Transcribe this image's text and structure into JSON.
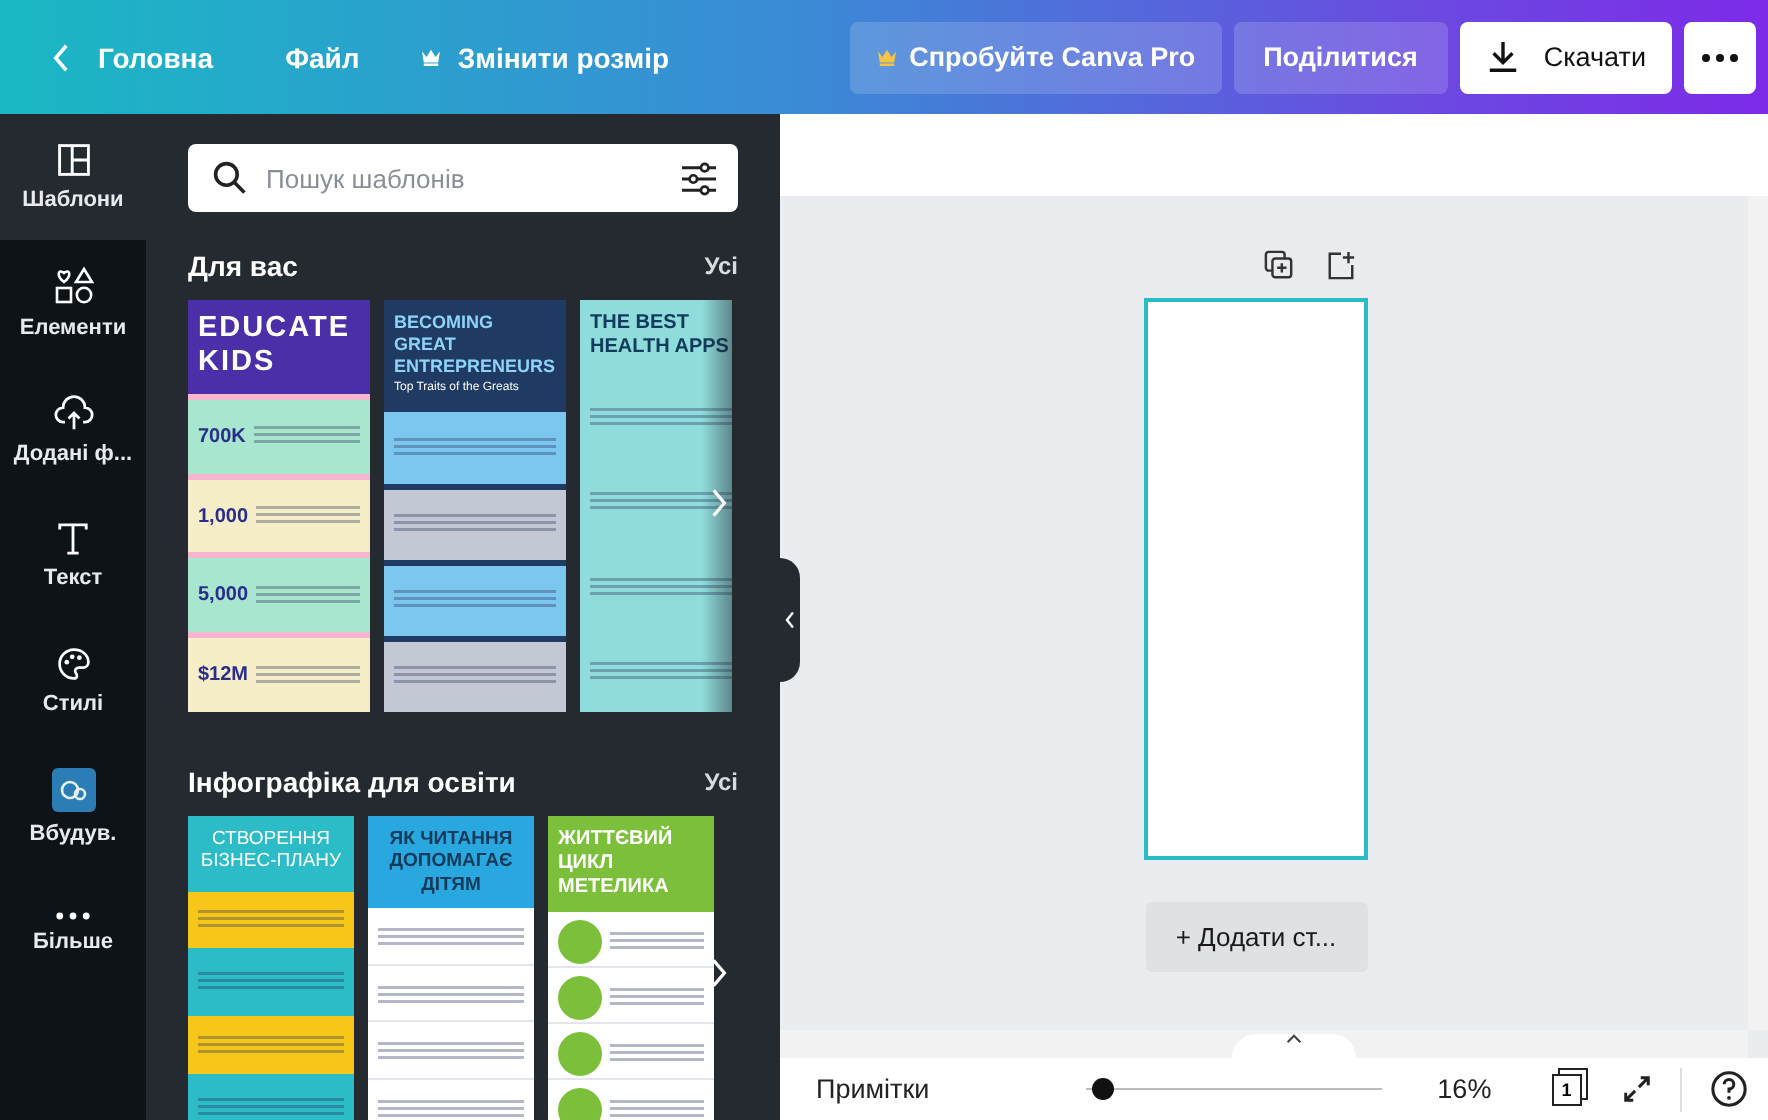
{
  "top_bar": {
    "back": "Головна",
    "menu": [
      {
        "label": "Файл",
        "kind": "plain"
      },
      {
        "label": "Змінити розмір",
        "kind": "crown"
      }
    ],
    "pro_button": "Спробуйте Canva Pro",
    "share_button": "Поділитися",
    "download_button": "Скачати"
  },
  "rail": [
    {
      "label": "Шаблони",
      "kind": "templates",
      "selected": true
    },
    {
      "label": "Елементи",
      "kind": "elements",
      "selected": false
    },
    {
      "label": "Додані ф...",
      "kind": "uploads",
      "selected": false
    },
    {
      "label": "Текст",
      "kind": "text",
      "selected": false
    },
    {
      "label": "Стилі",
      "kind": "styles",
      "selected": false
    },
    {
      "label": "Вбудув.",
      "kind": "embed",
      "selected": false
    },
    {
      "label": "Більше",
      "kind": "more",
      "selected": false
    }
  ],
  "search": {
    "placeholder": "Пошук шаблонів"
  },
  "sections": [
    {
      "title": "Для вас",
      "see_all": "Усі",
      "templates": [
        {
          "kind": "stats",
          "title": "EDUCATE KIDS",
          "figures": [
            "700K",
            "1,000",
            "5,000",
            "$12M"
          ]
        },
        {
          "kind": "traits",
          "title": "BECOMING GREAT ENTREPRENEURS",
          "subtitle": "Top Traits of the Greats"
        },
        {
          "kind": "list",
          "title": "THE BEST HEALTH APPS"
        }
      ]
    },
    {
      "title": "Інфографіка для освіти",
      "see_all": "Усі",
      "templates": [
        {
          "kind": "plan",
          "title": "СТВОРЕННЯ БІЗНЕС-ПЛАНУ"
        },
        {
          "kind": "reading",
          "title": "ЯК ЧИТАННЯ ДОПОМАГАЄ ДІТЯМ"
        },
        {
          "kind": "cycle",
          "title": "ЖИТТЄВИЙ ЦИКЛ МЕТЕЛИКА"
        }
      ]
    }
  ],
  "canvas": {
    "add_page": "+ Додати ст..."
  },
  "bottom_bar": {
    "notes": "Примітки",
    "zoom": {
      "level": 0.02,
      "reading": "16%"
    },
    "page_count": "1"
  }
}
